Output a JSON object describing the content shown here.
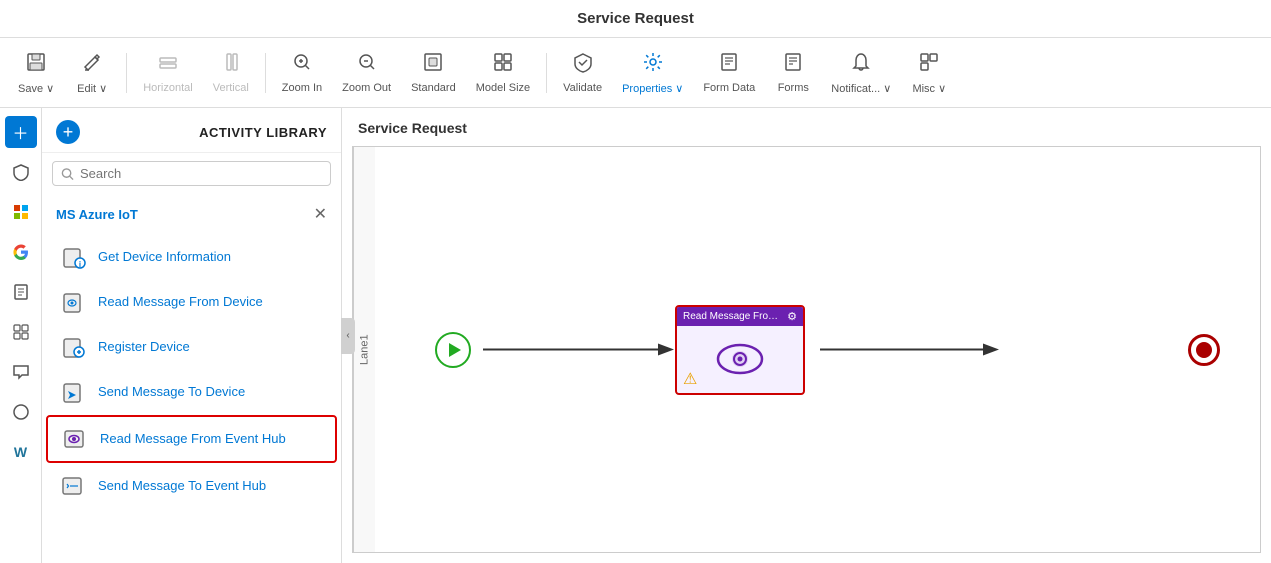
{
  "topbar": {
    "title": "Service Request"
  },
  "toolbar": {
    "items": [
      {
        "id": "save",
        "label": "Save ⌄",
        "icon": "💾",
        "disabled": false
      },
      {
        "id": "edit",
        "label": "Edit ⌄",
        "icon": "✏️",
        "disabled": false
      },
      {
        "id": "horizontal",
        "label": "Horizontal",
        "icon": "⊟",
        "disabled": true
      },
      {
        "id": "vertical",
        "label": "Vertical",
        "icon": "⊟",
        "disabled": true
      },
      {
        "id": "zoomin",
        "label": "Zoom In",
        "icon": "🔍",
        "disabled": false
      },
      {
        "id": "zoomout",
        "label": "Zoom Out",
        "icon": "🔍",
        "disabled": false
      },
      {
        "id": "standard",
        "label": "Standard",
        "icon": "⊡",
        "disabled": false
      },
      {
        "id": "modelsize",
        "label": "Model Size",
        "icon": "⊞",
        "disabled": false
      },
      {
        "id": "validate",
        "label": "Validate",
        "icon": "🛡",
        "disabled": false
      },
      {
        "id": "properties",
        "label": "Properties ⌄",
        "icon": "⚙️",
        "disabled": false
      },
      {
        "id": "formdata",
        "label": "Form Data",
        "icon": "📊",
        "disabled": false
      },
      {
        "id": "forms",
        "label": "Forms",
        "icon": "📄",
        "disabled": false
      },
      {
        "id": "notifications",
        "label": "Notificat... ⌄",
        "icon": "🔔",
        "disabled": false
      },
      {
        "id": "misc",
        "label": "Misc ⌄",
        "icon": "⊡",
        "disabled": false
      }
    ]
  },
  "sidebar": {
    "left_icons": [
      {
        "id": "add",
        "icon": "＋",
        "active": true
      },
      {
        "id": "shield",
        "icon": "🛡",
        "active": false
      },
      {
        "id": "office",
        "icon": "⊞",
        "active": false
      },
      {
        "id": "google",
        "icon": "◉",
        "active": false
      },
      {
        "id": "docs",
        "icon": "📋",
        "active": false
      },
      {
        "id": "grid",
        "icon": "⊞",
        "active": false
      },
      {
        "id": "chat",
        "icon": "💬",
        "active": false
      },
      {
        "id": "circle",
        "icon": "○",
        "active": false
      },
      {
        "id": "wp",
        "icon": "W",
        "active": false
      }
    ]
  },
  "activity_library": {
    "title": "ACTIVITY LIBRARY",
    "search_placeholder": "Search",
    "azure_section_title": "MS Azure IoT",
    "items": [
      {
        "id": "get-device-info",
        "label": "Get Device Information",
        "icon": "device"
      },
      {
        "id": "read-msg-device",
        "label": "Read Message From Device",
        "icon": "read"
      },
      {
        "id": "register-device",
        "label": "Register Device",
        "icon": "register"
      },
      {
        "id": "send-msg-device",
        "label": "Send Message To Device",
        "icon": "send"
      },
      {
        "id": "read-msg-hub",
        "label": "Read Message From Event Hub",
        "icon": "eye",
        "selected": true
      },
      {
        "id": "send-msg-hub",
        "label": "Send Message To Event Hub",
        "icon": "send2"
      }
    ]
  },
  "canvas": {
    "title": "Service Request",
    "lane_label": "Lane1",
    "node": {
      "header": "Read Message From Ev...",
      "gear_label": "⚙",
      "warning_label": "⚠"
    }
  }
}
